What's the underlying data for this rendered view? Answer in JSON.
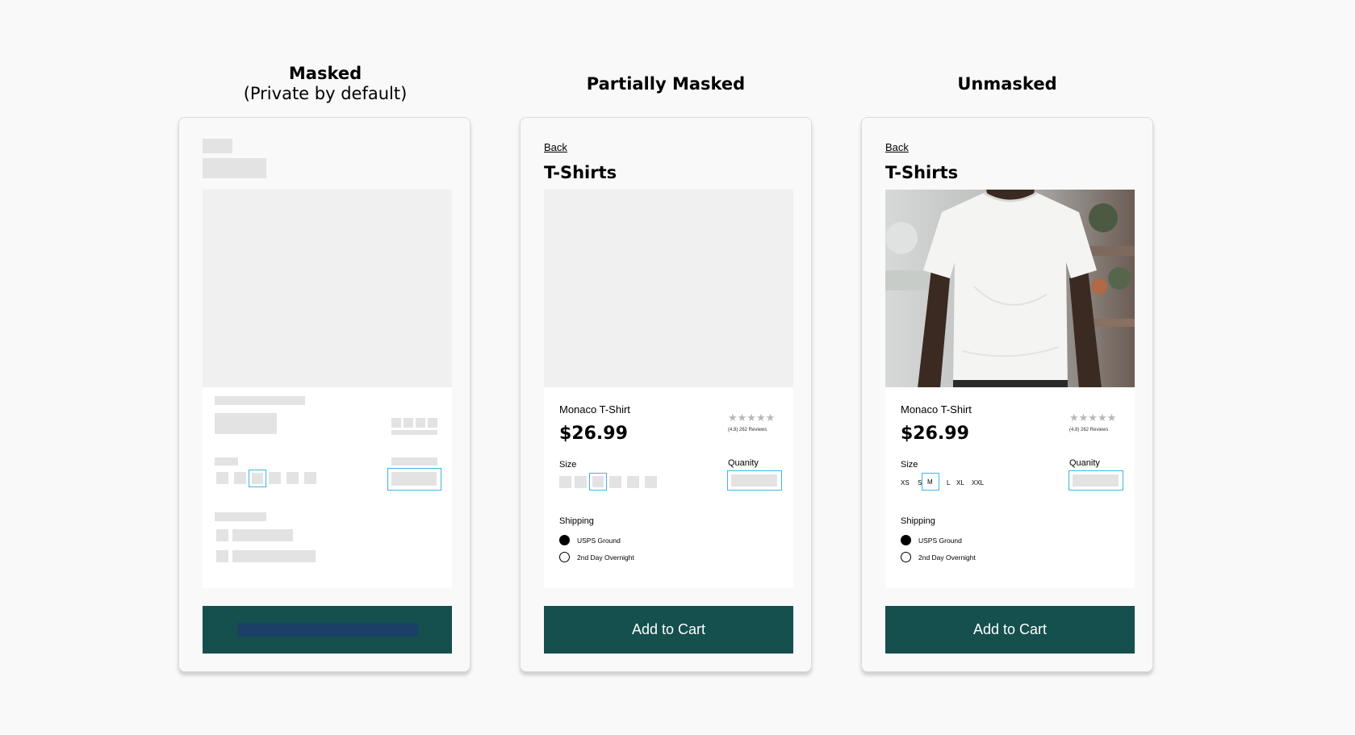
{
  "columns": {
    "masked": {
      "title": "Masked",
      "subtitle": "(Private by default)"
    },
    "partial": {
      "title": "Partially Masked"
    },
    "unmasked": {
      "title": "Unmasked"
    }
  },
  "product": {
    "back_label": "Back",
    "page_title": "T-Shirts",
    "name": "Monaco T-Shirt",
    "price": "$26.99",
    "stars": "★★★★★",
    "reviews": "(4.8) 262 Reviews",
    "size_label": "Size",
    "sizes": [
      "XS",
      "S",
      "M",
      "L",
      "XL",
      "XXL"
    ],
    "selected_size": "M",
    "quantity_label": "Quanity",
    "shipping_label": "Shipping",
    "shipping_options": [
      "USPS Ground",
      "2nd Day Overnight"
    ],
    "add_to_cart": "Add to Cart"
  },
  "colors": {
    "cta": "#154f4e",
    "masked_cta_bar": "#1b3f66",
    "highlight": "#3db7e4",
    "mask_gray": "#e3e3e3"
  },
  "icons": {
    "tshirt_photo": "photo of model wearing white t-shirt"
  }
}
